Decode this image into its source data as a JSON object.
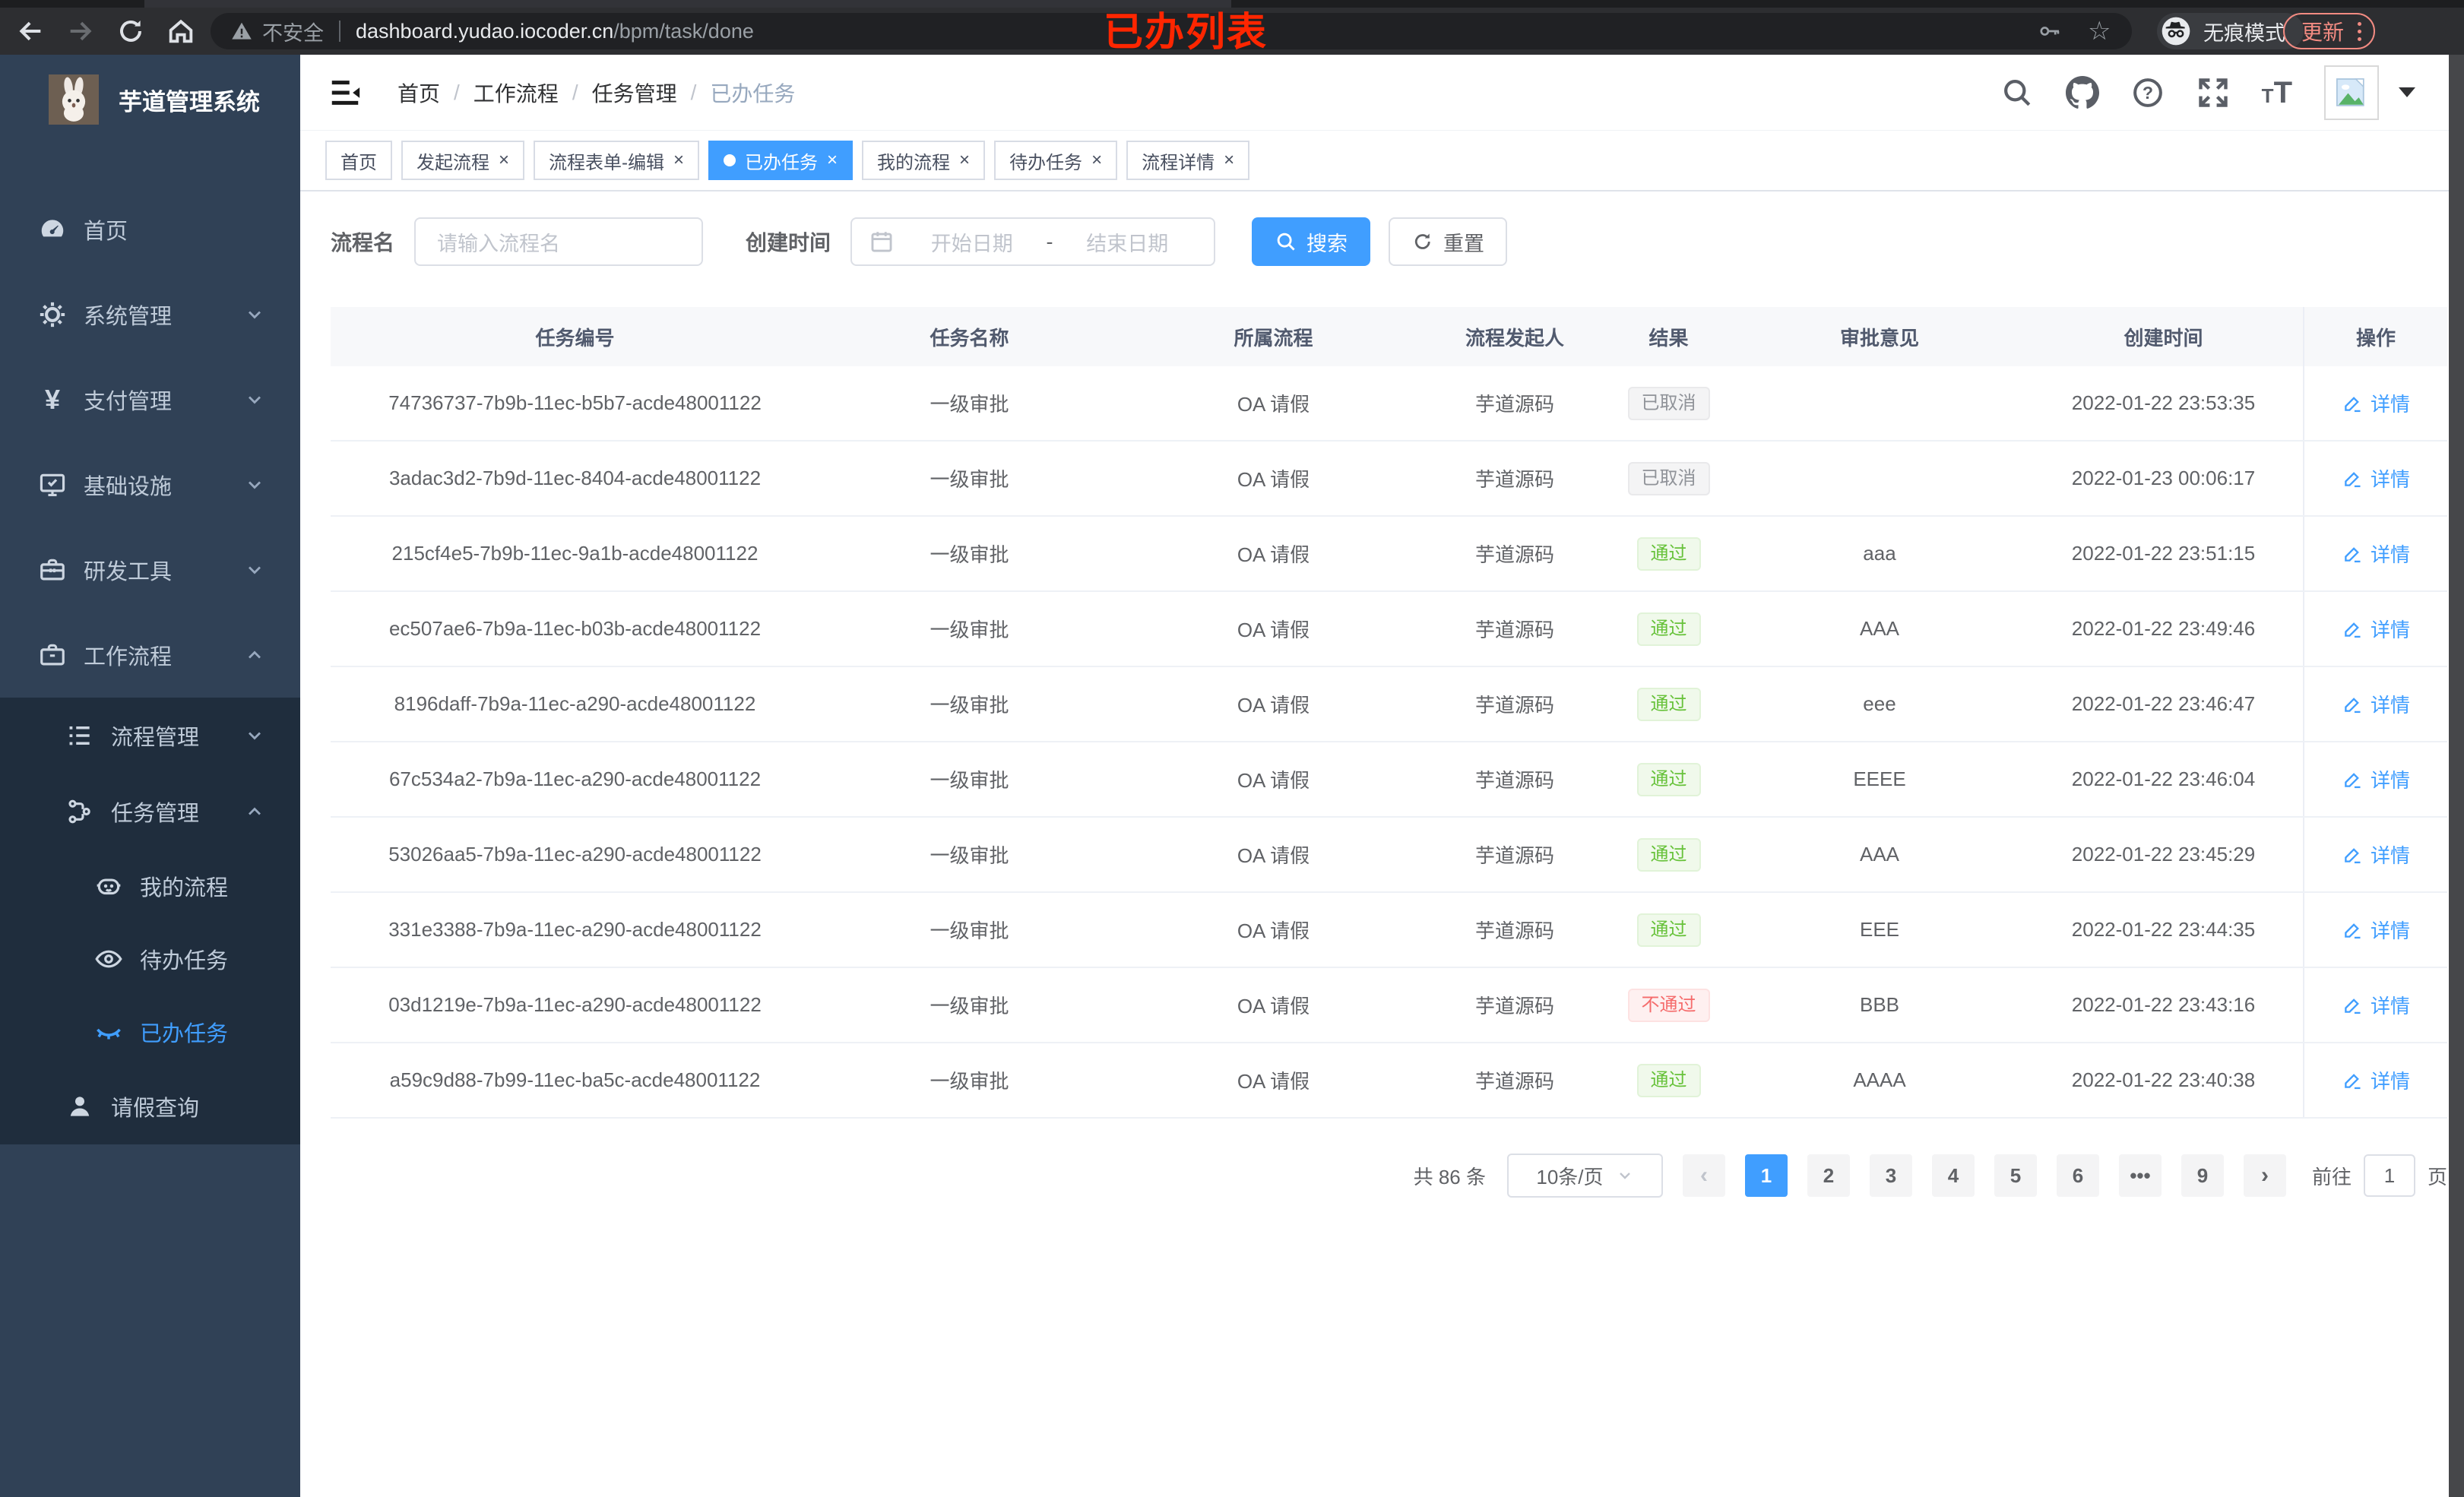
{
  "annotation": "已办列表",
  "browser": {
    "security_label": "不安全",
    "url_host": "dashboard.yudao.iocoder.cn",
    "url_path": "/bpm/task/done",
    "incognito_label": "无痕模式",
    "update_label": "更新"
  },
  "sidebar": {
    "app_title": "芋道管理系统",
    "menu": [
      {
        "label": "首页",
        "icon": "dashboard-icon",
        "level": 1
      },
      {
        "label": "系统管理",
        "icon": "gear-icon",
        "level": 1,
        "chevron": "down"
      },
      {
        "label": "支付管理",
        "icon": "yen-icon",
        "level": 1,
        "chevron": "down"
      },
      {
        "label": "基础设施",
        "icon": "monitor-icon",
        "level": 1,
        "chevron": "down"
      },
      {
        "label": "研发工具",
        "icon": "toolbox-icon",
        "level": 1,
        "chevron": "down"
      },
      {
        "label": "工作流程",
        "icon": "briefcase-icon",
        "level": 1,
        "chevron": "up"
      },
      {
        "label": "流程管理",
        "icon": "list-icon",
        "level": 2,
        "chevron": "down"
      },
      {
        "label": "任务管理",
        "icon": "tree-icon",
        "level": 2,
        "chevron": "up"
      },
      {
        "label": "我的流程",
        "icon": "robot-icon",
        "level": 3
      },
      {
        "label": "待办任务",
        "icon": "eye-open-icon",
        "level": 3
      },
      {
        "label": "已办任务",
        "icon": "eye-closed-icon",
        "level": 3,
        "active": true
      },
      {
        "label": "请假查询",
        "icon": "user-icon",
        "level": 2
      }
    ]
  },
  "header": {
    "breadcrumb": [
      "首页",
      "工作流程",
      "任务管理",
      "已办任务"
    ],
    "icons": [
      "search-icon",
      "github-icon",
      "help-icon",
      "fullscreen-icon",
      "font-size-icon",
      "avatar",
      "caret-down-icon"
    ]
  },
  "tabs": [
    {
      "label": "首页",
      "closable": false
    },
    {
      "label": "发起流程",
      "closable": true
    },
    {
      "label": "流程表单-编辑",
      "closable": true
    },
    {
      "label": "已办任务",
      "closable": true,
      "active": true
    },
    {
      "label": "我的流程",
      "closable": true
    },
    {
      "label": "待办任务",
      "closable": true
    },
    {
      "label": "流程详情",
      "closable": true
    }
  ],
  "filters": {
    "name_label": "流程名",
    "name_placeholder": "请输入流程名",
    "time_label": "创建时间",
    "start_placeholder": "开始日期",
    "range_separator": "-",
    "end_placeholder": "结束日期",
    "search_label": "搜索",
    "reset_label": "重置"
  },
  "table": {
    "columns": [
      "任务编号",
      "任务名称",
      "所属流程",
      "流程发起人",
      "结果",
      "审批意见",
      "创建时间",
      "操作"
    ],
    "detail_label": "详情",
    "rows": [
      {
        "id": "74736737-7b9b-11ec-b5b7-acde48001122",
        "name": "一级审批",
        "process": "OA 请假",
        "starter": "芋道源码",
        "result": "已取消",
        "result_type": "info",
        "comment": "",
        "time": "2022-01-22 23:53:35"
      },
      {
        "id": "3adac3d2-7b9d-11ec-8404-acde48001122",
        "name": "一级审批",
        "process": "OA 请假",
        "starter": "芋道源码",
        "result": "已取消",
        "result_type": "info",
        "comment": "",
        "time": "2022-01-23 00:06:17"
      },
      {
        "id": "215cf4e5-7b9b-11ec-9a1b-acde48001122",
        "name": "一级审批",
        "process": "OA 请假",
        "starter": "芋道源码",
        "result": "通过",
        "result_type": "success",
        "comment": "aaa",
        "time": "2022-01-22 23:51:15"
      },
      {
        "id": "ec507ae6-7b9a-11ec-b03b-acde48001122",
        "name": "一级审批",
        "process": "OA 请假",
        "starter": "芋道源码",
        "result": "通过",
        "result_type": "success",
        "comment": "AAA",
        "time": "2022-01-22 23:49:46"
      },
      {
        "id": "8196daff-7b9a-11ec-a290-acde48001122",
        "name": "一级审批",
        "process": "OA 请假",
        "starter": "芋道源码",
        "result": "通过",
        "result_type": "success",
        "comment": "eee",
        "time": "2022-01-22 23:46:47"
      },
      {
        "id": "67c534a2-7b9a-11ec-a290-acde48001122",
        "name": "一级审批",
        "process": "OA 请假",
        "starter": "芋道源码",
        "result": "通过",
        "result_type": "success",
        "comment": "EEEE",
        "time": "2022-01-22 23:46:04"
      },
      {
        "id": "53026aa5-7b9a-11ec-a290-acde48001122",
        "name": "一级审批",
        "process": "OA 请假",
        "starter": "芋道源码",
        "result": "通过",
        "result_type": "success",
        "comment": "AAA",
        "time": "2022-01-22 23:45:29"
      },
      {
        "id": "331e3388-7b9a-11ec-a290-acde48001122",
        "name": "一级审批",
        "process": "OA 请假",
        "starter": "芋道源码",
        "result": "通过",
        "result_type": "success",
        "comment": "EEE",
        "time": "2022-01-22 23:44:35"
      },
      {
        "id": "03d1219e-7b9a-11ec-a290-acde48001122",
        "name": "一级审批",
        "process": "OA 请假",
        "starter": "芋道源码",
        "result": "不通过",
        "result_type": "danger",
        "comment": "BBB",
        "time": "2022-01-22 23:43:16"
      },
      {
        "id": "a59c9d88-7b99-11ec-ba5c-acde48001122",
        "name": "一级审批",
        "process": "OA 请假",
        "starter": "芋道源码",
        "result": "通过",
        "result_type": "success",
        "comment": "AAAA",
        "time": "2022-01-22 23:40:38"
      }
    ]
  },
  "pagination": {
    "total_label": "共 86 条",
    "page_size": "10条/页",
    "pages": [
      "1",
      "2",
      "3",
      "4",
      "5",
      "6",
      "•••",
      "9"
    ],
    "active_page": "1",
    "prev_symbol": "‹",
    "next_symbol": "›",
    "goto_label": "前往",
    "goto_value": "1",
    "page_unit": "页"
  },
  "colors": {
    "accent": "#409eff",
    "sidebar_bg": "#304156",
    "submenu_bg": "#1f2d3d",
    "success_text": "#67c23a",
    "danger_text": "#f56c6c",
    "info_text": "#909399",
    "annotation_red": "#ff2600"
  }
}
